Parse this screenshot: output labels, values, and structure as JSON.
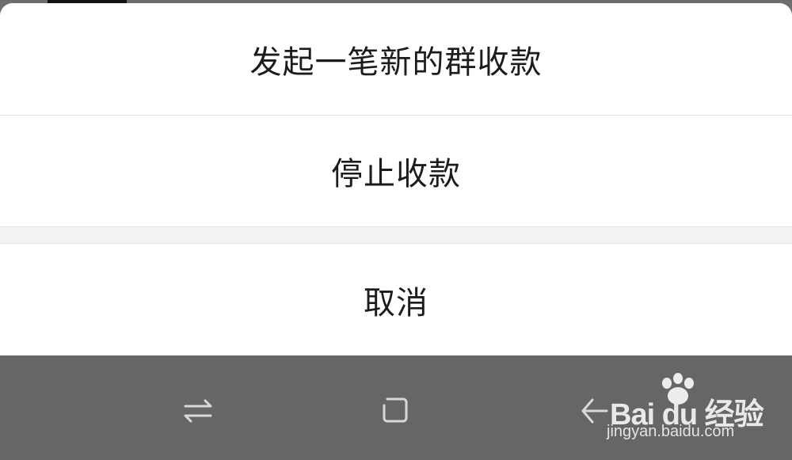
{
  "action_sheet": {
    "items": [
      {
        "label": "发起一笔新的群收款"
      },
      {
        "label": "停止收款"
      }
    ],
    "cancel_label": "取消"
  },
  "nav_bar": {
    "buttons": [
      {
        "icon": "recent-apps-icon"
      },
      {
        "icon": "home-icon"
      },
      {
        "icon": "back-icon"
      }
    ]
  },
  "watermark": {
    "brand": "Bai du 经验",
    "url": "jingyan.baidu.com"
  },
  "colors": {
    "sheet_background": "#ffffff",
    "navbar_background": "#666666",
    "text": "#1c1c1c",
    "divider": "#e3e3e3"
  }
}
